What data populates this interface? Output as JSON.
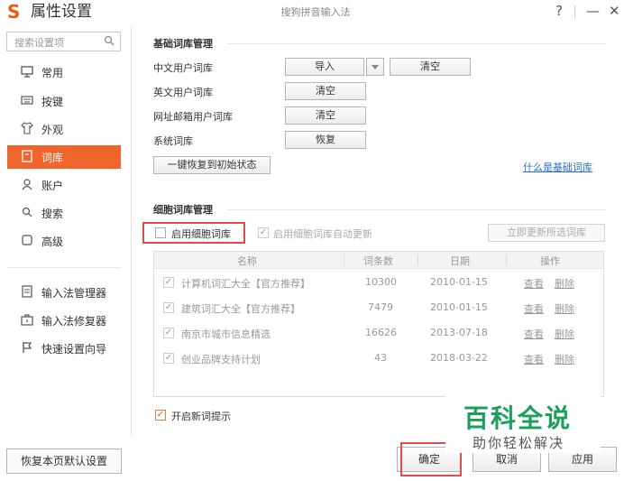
{
  "window": {
    "title": "属性设置",
    "subtitle": "搜狗拼音输入法",
    "help": "?",
    "minimize": "—",
    "close": "✕"
  },
  "sidebar": {
    "search_placeholder": "搜索设置项",
    "items": [
      {
        "label": "常用",
        "icon": "monitor-icon"
      },
      {
        "label": "按键",
        "icon": "keyboard-icon"
      },
      {
        "label": "外观",
        "icon": "shirt-icon"
      },
      {
        "label": "词库",
        "icon": "book-icon"
      },
      {
        "label": "账户",
        "icon": "user-icon"
      },
      {
        "label": "搜索",
        "icon": "search-icon"
      },
      {
        "label": "高级",
        "icon": "square-icon"
      }
    ],
    "tools": [
      {
        "label": "输入法管理器",
        "icon": "list-icon"
      },
      {
        "label": "输入法修复器",
        "icon": "toolbox-icon"
      },
      {
        "label": "快速设置向导",
        "icon": "flag-icon"
      }
    ],
    "restore_button": "恢复本页默认设置"
  },
  "basic": {
    "title": "基础词库管理",
    "rows": [
      {
        "label": "中文用户词库",
        "button1": "导入",
        "button2": "清空"
      },
      {
        "label": "英文用户词库",
        "button1": "清空"
      },
      {
        "label": "网址邮箱用户词库",
        "button1": "清空"
      },
      {
        "label": "系统词库",
        "button1": "恢复"
      }
    ],
    "reset_button": "一键恢复到初始状态",
    "help_link": "什么是基础词库"
  },
  "cell": {
    "title": "细胞词库管理",
    "enable_label": "启用细胞词库",
    "enable_checked": false,
    "auto_update_label": "启用细胞词库自动更新",
    "auto_update_checked": true,
    "update_button": "立即更新所选词库",
    "columns": [
      "名称",
      "词条数",
      "日期",
      "操作"
    ],
    "rows": [
      {
        "name": "计算机词汇大全【官方推荐】",
        "count": "10300",
        "date": "2010-01-15",
        "view": "查看",
        "delete": "删除"
      },
      {
        "name": "建筑词汇大全【官方推荐】",
        "count": "7479",
        "date": "2010-01-15",
        "view": "查看",
        "delete": "删除"
      },
      {
        "name": "南京市城市信息精选",
        "count": "16626",
        "date": "2013-07-18",
        "view": "查看",
        "delete": "删除"
      },
      {
        "name": "创业品牌支持计划",
        "count": "43",
        "date": "2018-03-22",
        "view": "查看",
        "delete": "删除"
      }
    ],
    "new_word_label": "开启新词提示",
    "new_word_checked": true
  },
  "footer": {
    "ok": "确定",
    "cancel": "取消",
    "apply": "应用"
  },
  "watermark": {
    "line1": "百科全说",
    "line2": "助你轻松解决"
  },
  "colors": {
    "accent": "#f0652b",
    "link": "#2a6dcc",
    "highlight": "#e04c4c",
    "watermark": "#1aa05a"
  }
}
